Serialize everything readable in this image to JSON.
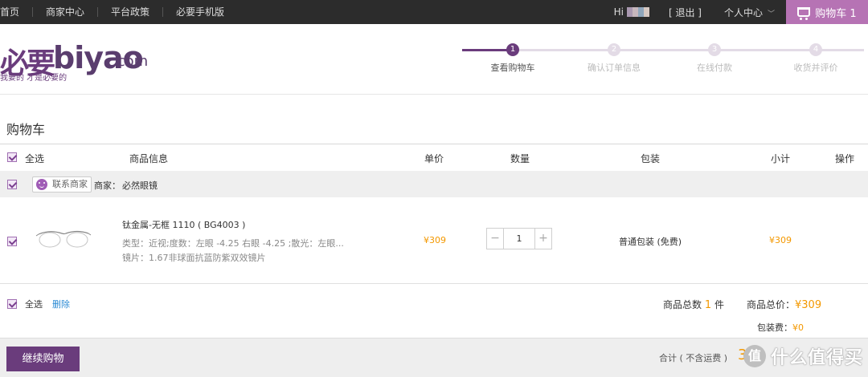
{
  "topbar": {
    "nav": [
      "首页",
      "商家中心",
      "平台政策",
      "必要手机版"
    ],
    "hi": "Hi",
    "logout": "[ 退出 ]",
    "user_center": "个人中心",
    "cart": "购物车 1"
  },
  "logo": {
    "zh": "必要",
    "en": "biyao",
    "com": ".com",
    "tagline": "我要的 才是必要的"
  },
  "steps": [
    {
      "num": "1",
      "label": "查看购物车"
    },
    {
      "num": "2",
      "label": "确认订单信息"
    },
    {
      "num": "3",
      "label": "在线付款"
    },
    {
      "num": "4",
      "label": "收货并评价"
    }
  ],
  "page_title": "购物车",
  "table_header": {
    "select_all": "全选",
    "product_info": "商品信息",
    "unit_price": "单价",
    "quantity": "数量",
    "packaging": "包装",
    "subtotal": "小计",
    "action": "操作"
  },
  "merchant": {
    "contact": "联系商家",
    "label": "商家：",
    "name": "必然眼镜"
  },
  "product": {
    "name": "钛金属-无框 1110 ( BG4003 )",
    "spec": "类型：近视;度数：左眼 -4.25 右眼 -4.25 ;散光：左眼...",
    "lens": "镜片：1.67非球面抗蓝防紫双效镜片",
    "unit_price": "¥309",
    "quantity": "1",
    "qty_minus": "−",
    "qty_plus": "+",
    "packaging": "普通包装 (免费)",
    "subtotal": "¥309"
  },
  "footer": {
    "select_all": "全选",
    "delete": "删除",
    "count_label": "商品总数",
    "count": "1",
    "count_unit": "件",
    "total_label": "商品总价：",
    "total": "¥309",
    "packing_label": "包装费：",
    "packing": "¥0"
  },
  "bottom": {
    "continue": "继续购物",
    "sum_label": "合计 ( 不含运费 )",
    "sum_value": "309",
    "watermark_icon": "值",
    "watermark_text": "什么值得买"
  }
}
